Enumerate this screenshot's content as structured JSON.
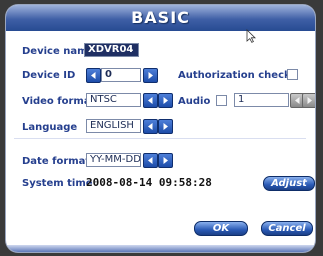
{
  "window": {
    "title": "BASIC"
  },
  "labels": {
    "device_name": "Device name",
    "device_id": "Device ID",
    "authorization_check": "Authorization check",
    "video_format": "Video format",
    "audio": "Audio",
    "language": "Language",
    "date_format": "Date format",
    "system_time": "System time"
  },
  "fields": {
    "device_name": "XDVR04",
    "device_id": "0",
    "video_format": "NTSC",
    "audio_channel": "1",
    "language": "ENGLISH",
    "date_format": "YY-MM-DD",
    "system_time": "2008-08-14 09:58:28"
  },
  "buttons": {
    "adjust": "Adjust",
    "ok": "OK",
    "cancel": "Cancel"
  },
  "checkboxes": {
    "authorization_check": false,
    "audio": false
  },
  "icons": [
    "left-arrow-icon",
    "right-arrow-icon",
    "mouse-cursor-icon"
  ]
}
